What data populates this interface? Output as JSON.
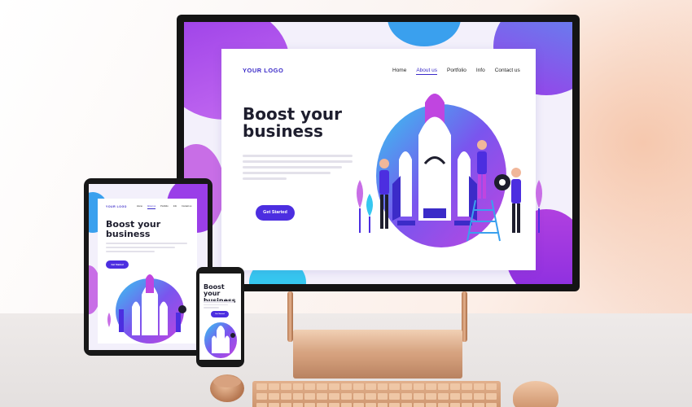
{
  "scene": "Responsive website landing page shown on desktop monitor, tablet and phone",
  "site": {
    "logo": "YOUR LOGO",
    "nav": [
      "Home",
      "About us",
      "Portfolio",
      "Info",
      "Contact us"
    ],
    "active_nav": "About us",
    "headline_line1": "Boost your",
    "headline_line2": "business",
    "cta_label": "Get Started"
  },
  "colors": {
    "primary": "#4c2ee0",
    "purple": "#9a3ee8",
    "magenta": "#c045e0",
    "blue": "#3aa0ee",
    "cyan": "#36c7f0",
    "copper": "#d8a684",
    "text_dark": "#1e1e2e"
  },
  "icons": [
    "rocket-illustration",
    "gear-icon",
    "plant-icon",
    "ladder-icon"
  ]
}
